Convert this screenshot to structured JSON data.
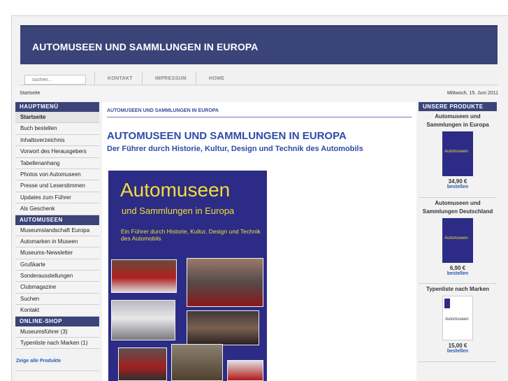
{
  "site": {
    "title": "AUTOMUSEEN UND SAMMLUNGEN IN EUROPA"
  },
  "search": {
    "placeholder": "suchen..."
  },
  "topnav": [
    "KONTAKT",
    "IMPRESSUM",
    "HOME"
  ],
  "breadcrumb": "Startseite",
  "date": "Mittwoch, 15. Juni 2011",
  "sidebar": {
    "menu_title": "HAUPTMENÜ",
    "menu_items": [
      "Startseite",
      "Buch bestellen",
      "Inhaltsverzeichnis",
      "Vorwort des Herausgebers",
      "Tabellenanhang",
      "Photos von Automuseen",
      "Presse und Leserstimmen",
      "Updates zum Führer",
      "Als Geschenk"
    ],
    "museum_title": "AUTOMUSEEN",
    "museum_items": [
      "Museumslandschaft Europa",
      "Automarken in Museen",
      "Museums-Newsletter",
      "Grußkarte",
      "Sonderausstellungen",
      "Clubmagazine",
      "Suchen",
      "Kontakt"
    ],
    "shop_title": "ONLINE-SHOP",
    "shop_items": [
      "Museumsführer (3)",
      "Typenliste nach Marken (1)"
    ],
    "show_all": "Zeige alle Produkte"
  },
  "main": {
    "heading_small": "AUTOMUSEEN UND SAMMLUNGEN IN EUROPA",
    "heading": "AUTOMUSEEN UND SAMMLUNGEN IN EUROPA",
    "subheading": "Der Führer durch Historie, Kultur, Design und Technik des Automobils",
    "cover_title": "Automuseen",
    "cover_subtitle": "und Sammlungen in Europa",
    "cover_text": "Ein Führer durch Historie, Kultur, Design und Technik des Automobils"
  },
  "products": {
    "title": "UNSERE PRODUKTE",
    "items": [
      {
        "name": "Automuseen und Sammlungen in Europa",
        "cover": "Automuseen",
        "price": "34,90 €",
        "action": "bestellen"
      },
      {
        "name": "Automuseen und Sammlungen Deutschland",
        "cover": "Automuseen",
        "price": "6,90 €",
        "action": "bestellen"
      },
      {
        "name": "Typenliste nach Marken",
        "cover": "Automuseen",
        "price": "15,00 €",
        "action": "bestellen"
      }
    ]
  },
  "colors": {
    "brand": "#3a4478",
    "heading": "#2e4aa8",
    "cover": "#2c2c86",
    "cover_text": "#f3dd38",
    "link": "#2a5bb0"
  }
}
